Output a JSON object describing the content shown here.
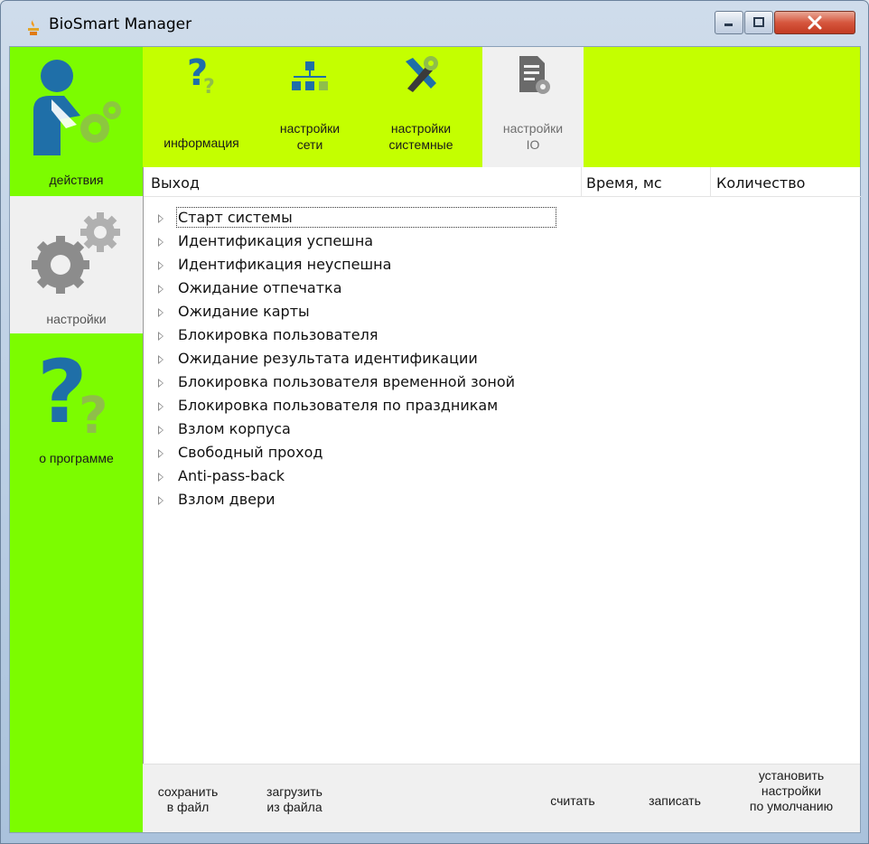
{
  "window": {
    "title": "BioSmart Manager"
  },
  "sidebar": {
    "items": [
      {
        "label": "действия",
        "icon": "user-gear-icon",
        "selected": false
      },
      {
        "label": "настройки",
        "icon": "gears-icon",
        "selected": true
      },
      {
        "label": "о программе",
        "icon": "question-icon",
        "selected": false
      }
    ]
  },
  "tabs": [
    {
      "label_line1": "информация",
      "label_line2": "",
      "icon": "question-icon",
      "selected": false
    },
    {
      "label_line1": "настройки",
      "label_line2": "сети",
      "icon": "network-icon",
      "selected": false
    },
    {
      "label_line1": "настройки",
      "label_line2": "системные",
      "icon": "tools-icon",
      "selected": false
    },
    {
      "label_line1": "настройки",
      "label_line2": "IO",
      "icon": "document-settings-icon",
      "selected": true
    }
  ],
  "table": {
    "columns": [
      "Выход",
      "Время, мс",
      "Количество"
    ],
    "rows": [
      "Старт системы",
      "Идентификация успешна",
      "Идентификация неуспешна",
      "Ожидание отпечатка",
      "Ожидание карты",
      "Блокировка пользователя",
      "Ожидание результата идентификации",
      "Блокировка пользователя временной зоной",
      "Блокировка пользователя по праздникам",
      "Взлом корпуса",
      "Свободный проход",
      "Anti-pass-back",
      "Взлом двери"
    ]
  },
  "bottom": {
    "save_line1": "сохранить",
    "save_line2": "в файл",
    "load_line1": "загрузить",
    "load_line2": "из файла",
    "read": "считать",
    "write": "записать",
    "defaults_line1": "установить",
    "defaults_line2": "настройки",
    "defaults_line3": "по умолчанию"
  },
  "colors": {
    "sidebar_bg": "#7cfc00",
    "topbar_bg": "#c4ff00",
    "icon_blue": "#1f6fa8",
    "icon_green": "#58a818"
  }
}
